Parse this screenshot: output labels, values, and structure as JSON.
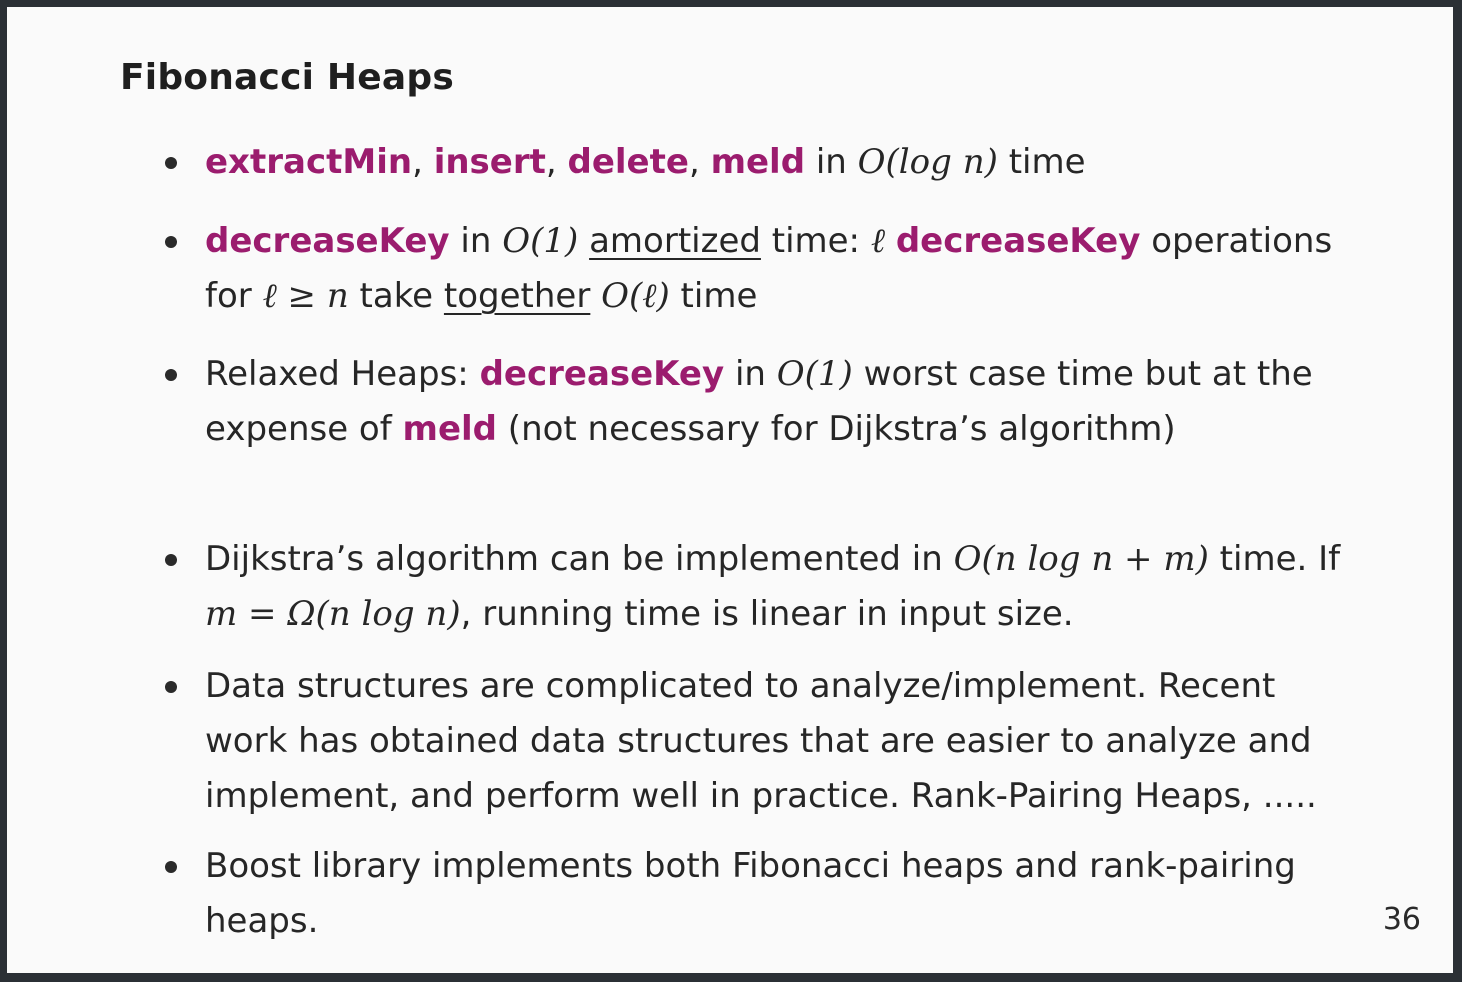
{
  "slide": {
    "title": "Fibonacci Heaps",
    "page_number": "36",
    "colors": {
      "keyword": "#9b1c6e",
      "text": "#262626",
      "background": "#fafafa",
      "frame": "#2b3035"
    }
  },
  "b1": {
    "k1": "extractMin",
    "s1": ", ",
    "k2": "insert",
    "s2": ", ",
    "k3": "delete",
    "s3": ", ",
    "k4": "meld",
    "s4": " in ",
    "math": "O(log n)",
    "s5": " time"
  },
  "b2": {
    "k1": "decreaseKey",
    "s1": " in ",
    "m1": "O(1)",
    "s2": " ",
    "u1": "amortized",
    "s3": " time: ",
    "m2": "ℓ",
    "s4": " ",
    "k2": "decreaseKey",
    "s5": " operations for ",
    "m3": "ℓ ≥ n",
    "s6": " take ",
    "u2": "together",
    "s7": " ",
    "m4": "O(ℓ)",
    "s8": " time"
  },
  "b3": {
    "s1": "Relaxed Heaps: ",
    "k1": "decreaseKey",
    "s2": " in ",
    "m1": "O(1)",
    "s3": " worst case time but at the expense of ",
    "k2": "meld",
    "s4": " (not necessary for Dijkstra’s algorithm)"
  },
  "b4": {
    "s1": "Dijkstra’s algorithm can be implemented in ",
    "m1": "O(n log n + m)",
    "s2": " time.  If ",
    "m2": "m = Ω(n log n)",
    "s3": ", running time is linear in input size."
  },
  "b5": {
    "text": "Data structures are complicated to analyze/implement.  Recent work has obtained data structures that are easier to analyze and implement, and perform well in practice.  Rank-Pairing Heaps, ....."
  },
  "b6": {
    "text": "Boost library implements both Fibonacci heaps and rank-pairing heaps."
  }
}
